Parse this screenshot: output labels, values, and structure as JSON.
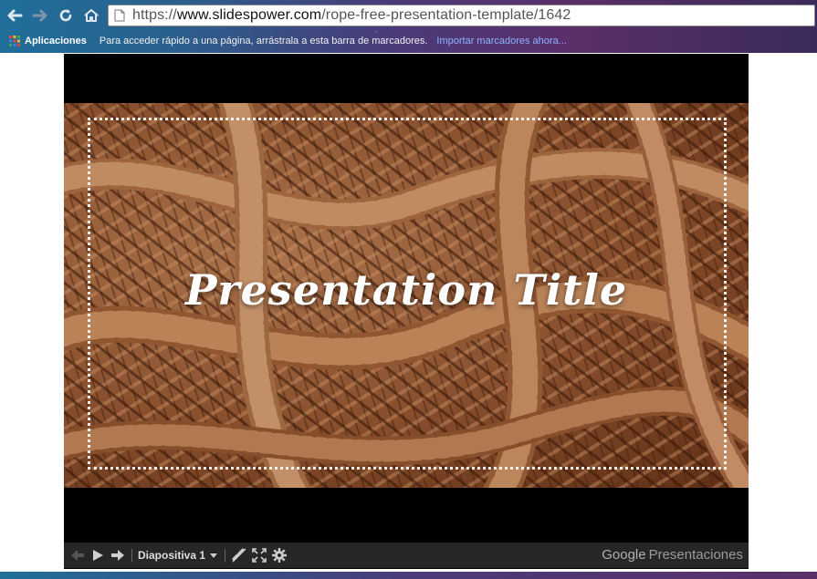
{
  "browser": {
    "url_scheme": "https://",
    "url_host": "www.slidespower.com",
    "url_path": "/rope-free-presentation-template/1642"
  },
  "bookmarks_bar": {
    "apps_label": "Aplicaciones",
    "hint_text": "Para acceder rápido a una página, arrástrala a esta barra de marcadores.",
    "import_link": "Importar marcadores ahora..."
  },
  "slide": {
    "title": "Presentation Title",
    "background_icon": "rope-photo"
  },
  "viewer_toolbar": {
    "slide_selector_label": "Diapositiva 1",
    "brand_google": "Google",
    "brand_product": "Presentaciones"
  },
  "colors": {
    "viewer_background": "#000000",
    "toolbar_background": "#262626",
    "link_blue": "#8fb2ff"
  }
}
